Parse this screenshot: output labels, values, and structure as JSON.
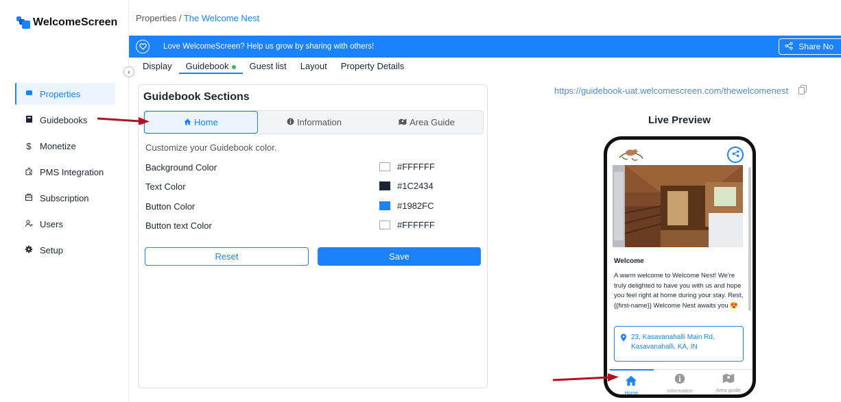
{
  "app": {
    "name": "WelcomeScreen"
  },
  "sidebar": {
    "items": [
      {
        "label": "Properties",
        "icon": "properties-icon"
      },
      {
        "label": "Guidebooks",
        "icon": "book-icon"
      },
      {
        "label": "Monetize",
        "icon": "dollar-icon"
      },
      {
        "label": "PMS Integration",
        "icon": "puzzle-icon"
      },
      {
        "label": "Subscription",
        "icon": "subscription-icon"
      },
      {
        "label": "Users",
        "icon": "users-icon"
      },
      {
        "label": "Setup",
        "icon": "gear-icon"
      }
    ],
    "active": "Properties"
  },
  "breadcrumb": {
    "root": "Properties",
    "sep": " / ",
    "current": "The Welcome Nest"
  },
  "banner": {
    "text": "Love WelcomeScreen? Help us grow by sharing with others!",
    "share_label": "Share No"
  },
  "tabs": [
    "Display",
    "Guidebook",
    "Guest list",
    "Layout",
    "Property Details"
  ],
  "active_tab": "Guidebook",
  "guidebook": {
    "title": "Guidebook Sections",
    "sections": [
      "Home",
      "Information",
      "Area Guide"
    ],
    "active_section": "Home",
    "customize_text": "Customize your Guidebook color.",
    "colors": [
      {
        "label": "Background Color",
        "hex": "#FFFFFF",
        "swatch": "#FFFFFF"
      },
      {
        "label": "Text Color",
        "hex": "#1C2434",
        "swatch": "#1C2434"
      },
      {
        "label": "Button Color",
        "hex": "#1982FC",
        "swatch": "#1982FC"
      },
      {
        "label": "Button text Color",
        "hex": "#FFFFFF",
        "swatch": "#FFFFFF"
      }
    ],
    "reset_label": "Reset",
    "save_label": "Save"
  },
  "preview": {
    "url": "https://guidebook-uat.welcomescreen.com/thewelcomenest",
    "title": "Live Preview",
    "welcome_heading": "Welcome",
    "welcome_text": "A warm welcome to Welcome Nest! We're truly delighted to have you with us and hope you feel right at home during your stay. Rest, {{first-name}} Welcome Nest awaits you 😍",
    "address": "23, Kasavanahalli Main Rd, Kasavanahalli, KA, IN",
    "bottom_nav": [
      "Home",
      "Information",
      "Area guide"
    ]
  },
  "colors": {
    "accent": "#1982FC",
    "text": "#1C2434",
    "annotation_arrow": "#B3121C"
  }
}
